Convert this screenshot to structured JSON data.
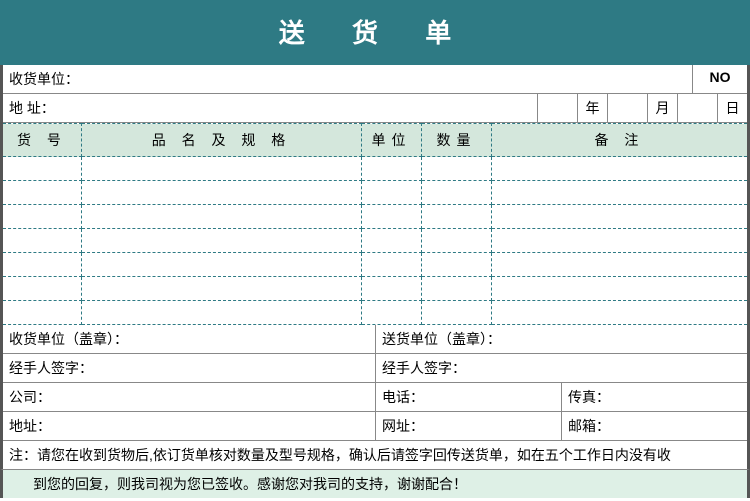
{
  "title": "送 货 单",
  "recipient_label": "收货单位：",
  "no_label": "NO",
  "address_label": "地 址：",
  "date": {
    "year": "年",
    "month": "月",
    "day": "日"
  },
  "headers": {
    "code": "货 号",
    "spec": "品 名 及 规 格",
    "unit": "单位",
    "qty": "数量",
    "remark": "备   注"
  },
  "sig": {
    "recv_stamp": "收货单位（盖章）：",
    "send_stamp": "送货单位（盖章）：",
    "recv_sign": "经手人签字：",
    "send_sign": "经手人签字："
  },
  "contact": {
    "company": "公司：",
    "phone": "电话：",
    "fax": "传真：",
    "addr": "地址：",
    "web": "网址：",
    "email": "邮箱："
  },
  "note1": "注：请您在收到货物后,依订货单核对数量及型号规格，确认后请签字回传送货单，如在五个工作日内没有收",
  "note2": "到您的回复，则我司视为您已签收。感谢您对我司的支持，谢谢配合！"
}
